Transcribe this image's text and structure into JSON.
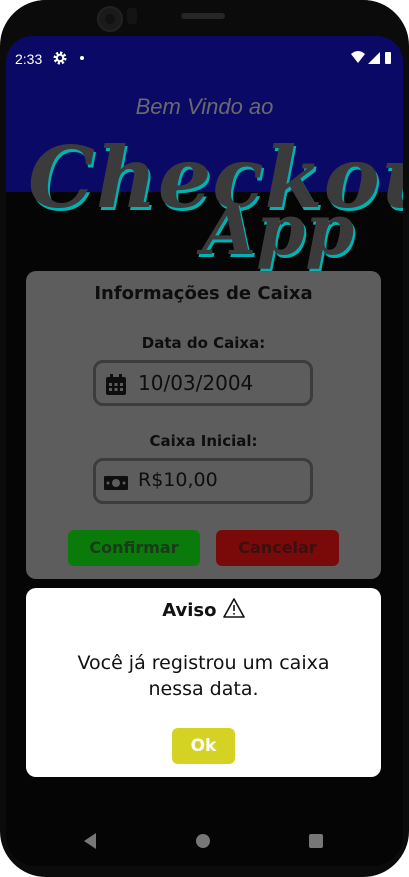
{
  "status_bar": {
    "time": "2:33",
    "icons": [
      "gear-icon",
      "notification-dot",
      "wifi-icon",
      "signal-icon",
      "battery-icon"
    ]
  },
  "header": {
    "welcome": "Bem Vindo ao",
    "brand_line1": "Checkout",
    "brand_line2": "App"
  },
  "cash_form": {
    "title": "Informações de Caixa",
    "date_label": "Data do Caixa:",
    "date_value": "10/03/2004",
    "date_icon": "calendar-icon",
    "initial_label": "Caixa Inicial:",
    "initial_value": "R$10,00",
    "money_icon": "money-bill-icon",
    "confirm_label": "Confirmar",
    "cancel_label": "Cancelar"
  },
  "dialog": {
    "title": "Aviso",
    "title_icon": "warning-icon",
    "message": "Você já registrou um caixa nessa data.",
    "ok_label": "Ok"
  },
  "nav": {
    "back": "back-icon",
    "home": "home-icon",
    "recents": "recents-icon"
  },
  "colors": {
    "hero_bg": "#0a0a66",
    "brand_accent": "#00b3b3",
    "card_bg": "#5d5d5d",
    "confirm": "#0a7a0a",
    "cancel": "#7a0a0a",
    "ok": "#d4d222"
  }
}
